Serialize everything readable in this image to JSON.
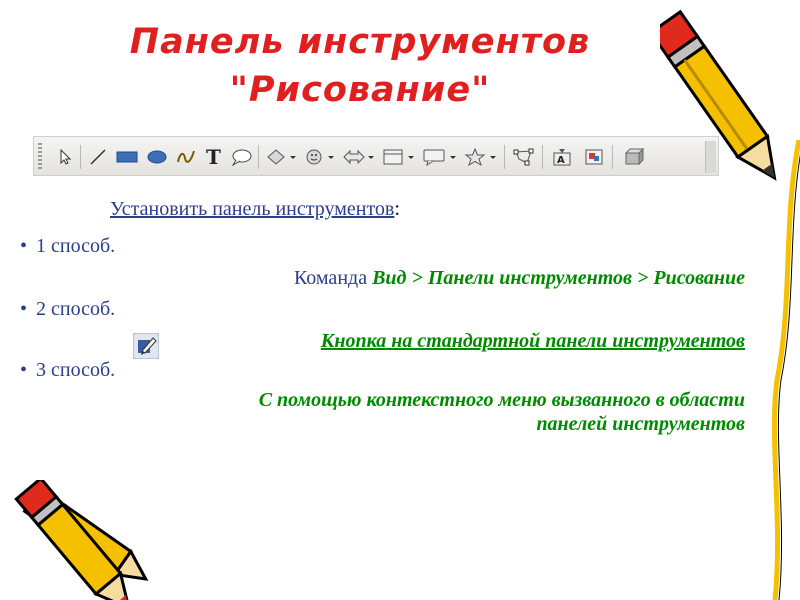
{
  "slide": {
    "title_line1": "Панель инструментов",
    "title_line2": "\"Рисование\"",
    "subtitle": "Установить панель инструментов",
    "subtitle_colon": ":"
  },
  "toolbar_icons": [
    "select-arrow-icon",
    "line-icon",
    "rectangle-icon",
    "ellipse-icon",
    "curve-icon",
    "text-icon",
    "callout-icon",
    "basic-shapes-icon",
    "symbol-shapes-icon",
    "block-arrows-icon",
    "flowchart-icon",
    "callouts-icon",
    "stars-icon",
    "points-icon",
    "fontwork-icon",
    "extrusion-icon",
    "3d-icon"
  ],
  "methods": [
    {
      "bullet": "•",
      "label": "1 способ.",
      "detail_prefix": "Команда ",
      "detail_emph": "Вид > Панели инструментов > Рисование"
    },
    {
      "bullet": "•",
      "label": "2 способ.",
      "detail": "Кнопка на стандартной панели инструментов"
    },
    {
      "bullet": "•",
      "label": "3 способ.",
      "detail_line1": "С помощью контекстного меню вызванного в области",
      "detail_line2": "панелей инструментов"
    }
  ],
  "colors": {
    "title": "#e0201e",
    "text": "#2a3d8f",
    "emphasis": "#008a00"
  }
}
